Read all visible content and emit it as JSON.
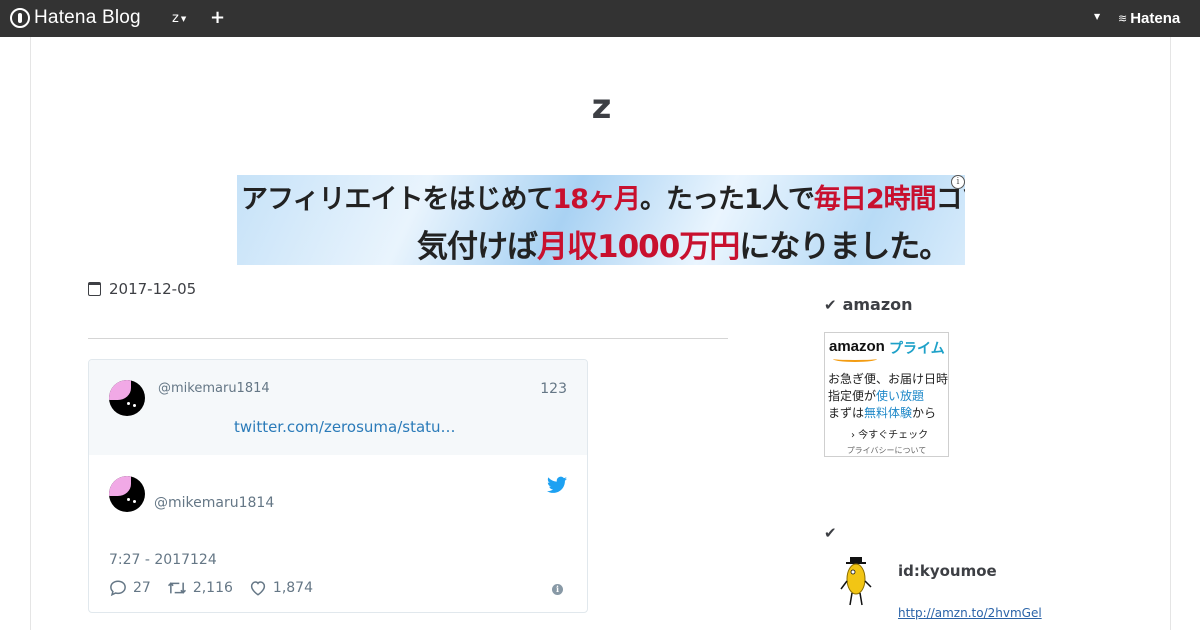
{
  "topbar": {
    "brand": "Hatena Blog",
    "blog_switch": "z",
    "plus": "+",
    "hatena_logo": "Hatena"
  },
  "blog": {
    "title": "z"
  },
  "banner": {
    "line1_a": "アフィリエイトをはじめて",
    "line1_b": "18ヶ月",
    "line1_c": "。たった1人で",
    "line1_d": "毎日2時間",
    "line1_e": "コツコツと。",
    "line2_a": "気付けば",
    "line2_b": "月収1000万円",
    "line2_c": "になりました。",
    "info": "i"
  },
  "entry": {
    "date": "2017-12-05"
  },
  "tweet": {
    "quoted_handle": "@mikemaru1814",
    "quoted_count": "123",
    "quoted_link": "twitter.com/zerosuma/statu…",
    "handle": "@mikemaru1814",
    "time": "7:27 - 2017124",
    "replies": "27",
    "retweets": "2,116",
    "likes": "1,874",
    "info": "i"
  },
  "sidebar": {
    "amazon_heading": "amazon",
    "ad": {
      "logo": "amazon",
      "prime": "プライム",
      "line1": "お急ぎ便、お届け日時",
      "line2_a": "指定便が",
      "line2_b": "使い放題",
      "line3_a": "まずは",
      "line3_b": "無料体験",
      "line3_c": "から",
      "check_now": "› 今すぐチェック",
      "privacy": "プライバシーについて"
    },
    "profile_id": "id:kyoumoe",
    "profile_link": "http://amzn.to/2hvmGel"
  },
  "colors": {
    "topbar": "#333333",
    "link": "#2b7bb9",
    "banner_red": "#c8102e",
    "prime_blue": "#1ea1c8",
    "twitter_blue": "#1da1f2"
  }
}
